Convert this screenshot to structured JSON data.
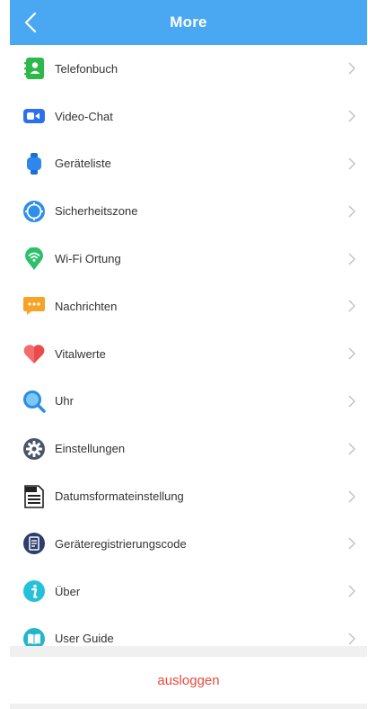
{
  "header": {
    "title": "More",
    "back_icon": "chevron-left-icon",
    "color": "#4aa8f2"
  },
  "menu": [
    {
      "label": "Telefonbuch",
      "icon": "phonebook-icon"
    },
    {
      "label": "Video-Chat",
      "icon": "video-camera-icon"
    },
    {
      "label": "Geräteliste",
      "icon": "smartwatch-icon"
    },
    {
      "label": "Sicherheitszone",
      "icon": "safe-zone-icon"
    },
    {
      "label": "Wi-Fi Ortung",
      "icon": "wifi-location-icon"
    },
    {
      "label": "Nachrichten",
      "icon": "message-icon"
    },
    {
      "label": "Vitalwerte",
      "icon": "heart-icon"
    },
    {
      "label": "Uhr",
      "icon": "magnifier-icon"
    },
    {
      "label": "Einstellungen",
      "icon": "gear-icon"
    },
    {
      "label": "Datumsformateinstellung",
      "icon": "dat-file-icon"
    },
    {
      "label": "Geräteregistrierungscode",
      "icon": "document-icon"
    },
    {
      "label": "Über",
      "icon": "info-icon"
    },
    {
      "label": "User Guide",
      "icon": "book-icon"
    }
  ],
  "logout": {
    "label": "ausloggen",
    "color": "#e84a3c"
  }
}
